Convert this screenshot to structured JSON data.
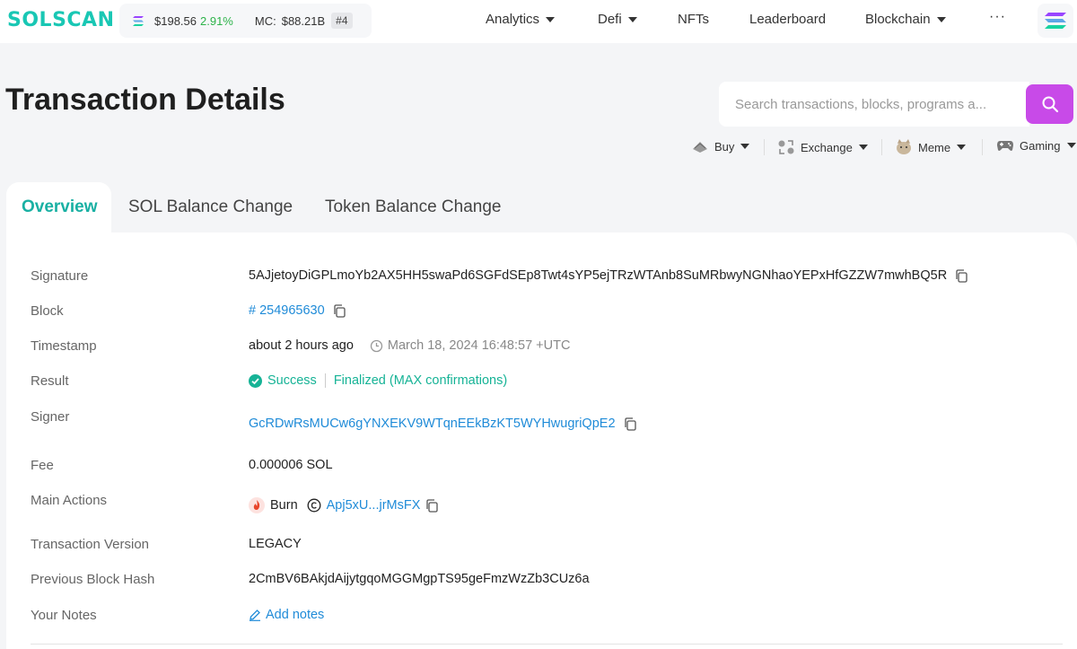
{
  "header": {
    "logo": "SOLSCAN",
    "price": "$198.56",
    "price_change": "2.91%",
    "mc_label": "MC:",
    "mc_value": "$88.21B",
    "rank": "#4",
    "nav": [
      "Analytics",
      "Defi",
      "NFTs",
      "Leaderboard",
      "Blockchain"
    ],
    "more": "···"
  },
  "page_title": "Transaction Details",
  "search": {
    "placeholder": "Search transactions, blocks, programs a..."
  },
  "quick_links": [
    "Buy",
    "Exchange",
    "Meme",
    "Gaming"
  ],
  "tabs": [
    "Overview",
    "SOL Balance Change",
    "Token Balance Change"
  ],
  "details": {
    "signature_label": "Signature",
    "signature": "5AJjetoyDiGPLmoYb2AX5HH5swaPd6SGFdSEp8Twt4sYP5ejTRzWTAnb8SuMRbwyNGNhaoYEPxHfGZZW7mwhBQ5R",
    "block_label": "Block",
    "block": "# 254965630",
    "timestamp_label": "Timestamp",
    "timestamp_relative": "about 2 hours ago",
    "timestamp_absolute": "March 18, 2024 16:48:57 +UTC",
    "result_label": "Result",
    "result_status": "Success",
    "result_finality": "Finalized (MAX confirmations)",
    "signer_label": "Signer",
    "signer": "GcRDwRsMUCw6gYNXEKV9WTqnEEkBzKT5WYHwugriQpE2",
    "fee_label": "Fee",
    "fee": "0.000006 SOL",
    "main_actions_label": "Main Actions",
    "action_type": "Burn",
    "action_token": "Apj5xU...jrMsFX",
    "version_label": "Transaction Version",
    "version": "LEGACY",
    "prev_hash_label": "Previous Block Hash",
    "prev_hash": "2CmBV6BAkjdAijytgqoMGGMgpTS95geFmzWzZb3CUz6a",
    "notes_label": "Your Notes",
    "notes_action": "Add notes"
  },
  "colors": {
    "brand": "#19c7b4",
    "accent_search": "#c84ae8",
    "link": "#1f8bd8",
    "success": "#16b396",
    "positive_change": "#2db34a"
  }
}
